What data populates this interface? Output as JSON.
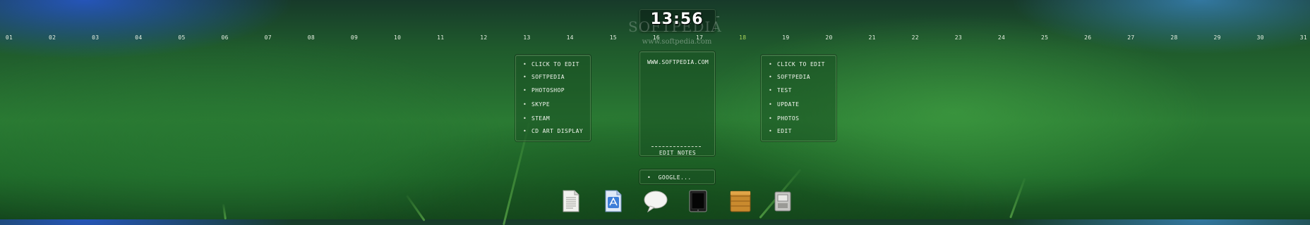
{
  "clock": {
    "time": "13:56"
  },
  "watermark": {
    "big": "SOFTPEDIA",
    "small": "www.softpedia.com",
    "tm": "™"
  },
  "calendar": {
    "days": [
      "01",
      "02",
      "03",
      "04",
      "05",
      "06",
      "07",
      "08",
      "09",
      "10",
      "11",
      "12",
      "13",
      "14",
      "15",
      "16",
      "17",
      "18",
      "19",
      "20",
      "21",
      "22",
      "23",
      "24",
      "25",
      "26",
      "27",
      "28",
      "29",
      "30",
      "31"
    ],
    "today": "18",
    "today_color": "#a8d35a"
  },
  "left_panel": {
    "bullet": "•",
    "items": [
      "CLICK TO EDIT",
      "SOFTPEDIA",
      "PHOTOSHOP",
      "SKYPE",
      "STEAM",
      "CD ART DISPLAY"
    ]
  },
  "notes": {
    "url": "WWW.SOFTPEDIA.COM",
    "edit_label": "EDIT NOTES"
  },
  "right_panel": {
    "bullet": "•",
    "items": [
      "CLICK TO EDIT",
      "SOFTPEDIA",
      "TEST",
      "UPDATE",
      "PHOTOS",
      "EDIT"
    ]
  },
  "search": {
    "bullet": "•",
    "text": "GOOGLE..."
  },
  "dock": {
    "icons": [
      "document-icon",
      "app-document-icon",
      "speech-bubble-icon",
      "tablet-icon",
      "wooden-box-icon",
      "drive-icon"
    ]
  },
  "colors": {
    "panel_bg": "#1c5025",
    "accent": "#a8d35a"
  }
}
